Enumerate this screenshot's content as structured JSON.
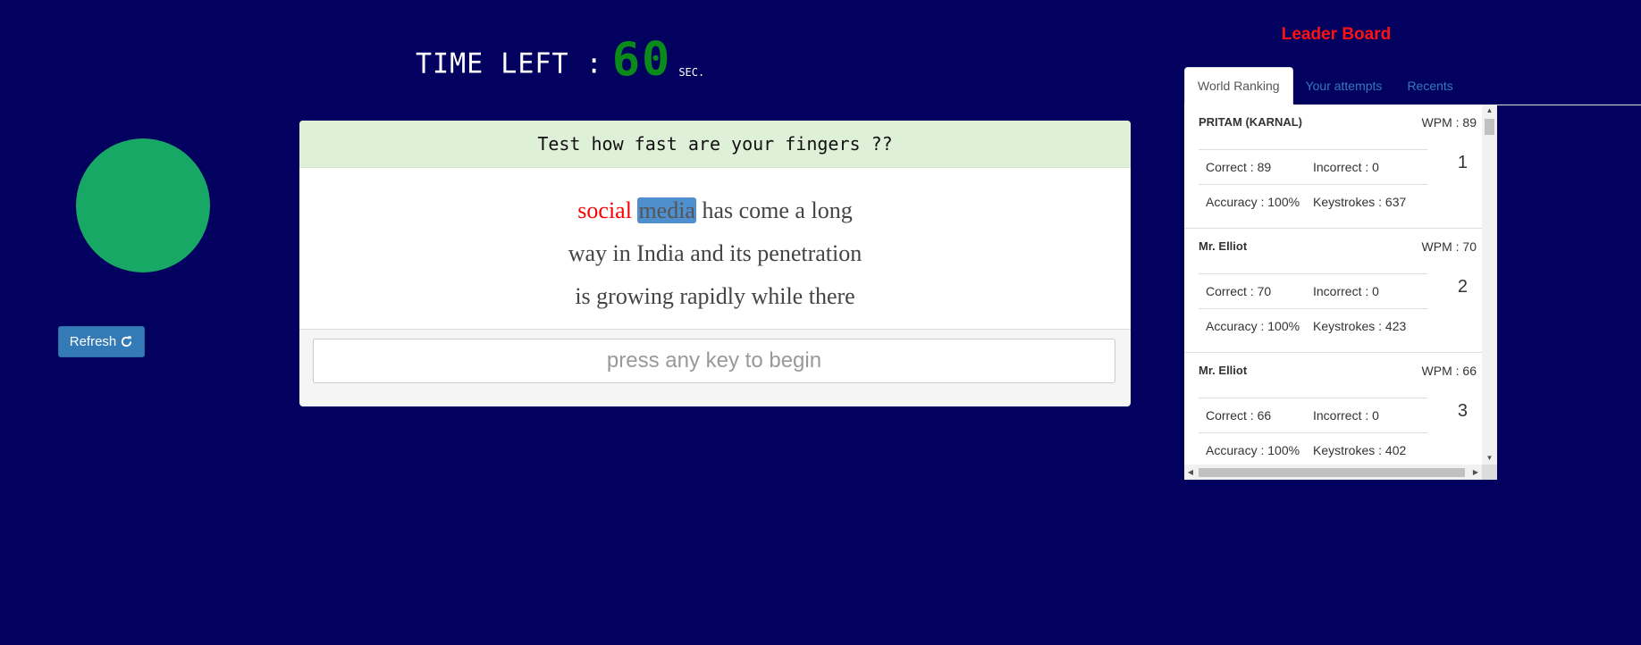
{
  "timer": {
    "label": "TIME LEFT :",
    "value": "60",
    "unit": "SEC."
  },
  "refresh": {
    "label": "Refresh",
    "icon": "refresh-icon"
  },
  "test": {
    "header": "Test how fast are your fingers ??",
    "words_line1": {
      "typed_wrong": "social",
      "current": "media",
      "rest": "has come a long"
    },
    "line2": "way in India and its penetration",
    "line3": "is growing rapidly while there",
    "input_placeholder": "press any key to begin"
  },
  "leaderboard": {
    "title": "Leader Board",
    "tabs": [
      "World Ranking",
      "Your attempts",
      "Recents"
    ],
    "active_tab": "World Ranking",
    "entries": [
      {
        "name": "PRITAM (KARNAL)",
        "wpm": "WPM : 89",
        "rank": "1",
        "correct": "Correct : 89",
        "incorrect": "Incorrect : 0",
        "accuracy": "Accuracy : 100%",
        "keystrokes": "Keystrokes : 637"
      },
      {
        "name": "Mr. Elliot",
        "wpm": "WPM : 70",
        "rank": "2",
        "correct": "Correct : 70",
        "incorrect": "Incorrect : 0",
        "accuracy": "Accuracy : 100%",
        "keystrokes": "Keystrokes : 423"
      },
      {
        "name": "Mr. Elliot",
        "wpm": "WPM : 66",
        "rank": "3",
        "correct": "Correct : 66",
        "incorrect": "Incorrect : 0",
        "accuracy": "Accuracy : 100%",
        "keystrokes": "Keystrokes : 402"
      }
    ]
  },
  "colors": {
    "background": "#02015f",
    "timer_digits": "#0a8a1a",
    "circle": "#16a864",
    "leaderboard_title": "#ff1111",
    "wrong_word": "#ff0000",
    "current_word_highlight": "#4f8fcd"
  }
}
